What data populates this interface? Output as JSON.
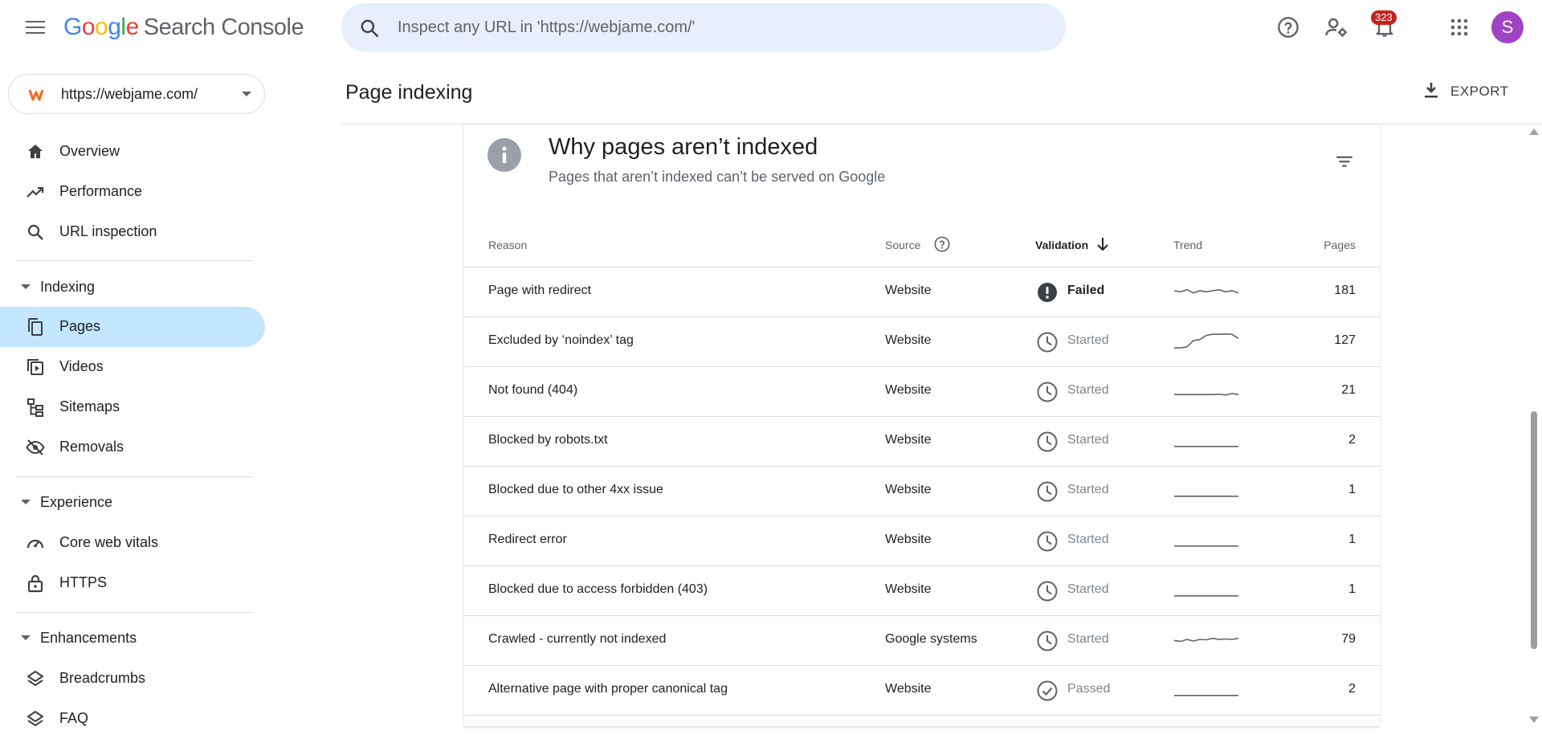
{
  "app": {
    "logo_google": [
      "G",
      "o",
      "o",
      "g",
      "l",
      "e"
    ],
    "product": "Search Console"
  },
  "search": {
    "placeholder": "Inspect any URL in 'https://webjame.com/'"
  },
  "topbar": {
    "notification_count": "323",
    "avatar_initial": "S"
  },
  "property": {
    "label": "https://webjame.com/"
  },
  "sidebar": {
    "top_items": [
      {
        "label": "Overview",
        "icon": "home-icon"
      },
      {
        "label": "Performance",
        "icon": "trending-up-icon"
      },
      {
        "label": "URL inspection",
        "icon": "search-icon"
      }
    ],
    "sections": {
      "indexing": {
        "label": "Indexing",
        "items": [
          {
            "label": "Pages",
            "icon": "pages-icon",
            "active": true
          },
          {
            "label": "Videos",
            "icon": "video-icon"
          },
          {
            "label": "Sitemaps",
            "icon": "sitemap-icon"
          },
          {
            "label": "Removals",
            "icon": "eye-off-icon"
          }
        ]
      },
      "experience": {
        "label": "Experience",
        "items": [
          {
            "label": "Core web vitals",
            "icon": "speedometer-icon"
          },
          {
            "label": "HTTPS",
            "icon": "lock-icon"
          }
        ]
      },
      "enhancements": {
        "label": "Enhancements",
        "items": [
          {
            "label": "Breadcrumbs",
            "icon": "layers-icon"
          },
          {
            "label": "FAQ",
            "icon": "layers-icon"
          }
        ]
      }
    }
  },
  "page": {
    "title": "Page indexing",
    "export_label": "EXPORT"
  },
  "card": {
    "title": "Why pages aren’t indexed",
    "subtitle": "Pages that aren’t indexed can’t be served on Google",
    "columns": {
      "reason": "Reason",
      "source": "Source",
      "validation": "Validation",
      "trend": "Trend",
      "pages": "Pages"
    },
    "rows": [
      {
        "reason": "Page with redirect",
        "source": "Website",
        "validation": "Failed",
        "status": "failed",
        "pages": "181",
        "trend": [
          0.5,
          0.45,
          0.55,
          0.4,
          0.5,
          0.45,
          0.5,
          0.55,
          0.45,
          0.5,
          0.4
        ]
      },
      {
        "reason": "Excluded by ‘noindex’ tag",
        "source": "Website",
        "validation": "Started",
        "status": "started",
        "pages": "127",
        "trend": [
          0.15,
          0.15,
          0.2,
          0.5,
          0.55,
          0.75,
          0.8,
          0.8,
          0.82,
          0.8,
          0.6
        ]
      },
      {
        "reason": "Not found (404)",
        "source": "Website",
        "validation": "Started",
        "status": "started",
        "pages": "21",
        "trend": [
          0.3,
          0.3,
          0.3,
          0.3,
          0.3,
          0.3,
          0.3,
          0.32,
          0.28,
          0.35,
          0.3
        ]
      },
      {
        "reason": "Blocked by robots.txt",
        "source": "Website",
        "validation": "Started",
        "status": "started",
        "pages": "2",
        "trend": [
          0.2,
          0.2,
          0.2,
          0.2,
          0.2,
          0.2,
          0.2,
          0.2,
          0.2,
          0.2,
          0.2
        ]
      },
      {
        "reason": "Blocked due to other 4xx issue",
        "source": "Website",
        "validation": "Started",
        "status": "started",
        "pages": "1",
        "trend": [
          0.2,
          0.2,
          0.2,
          0.2,
          0.2,
          0.2,
          0.2,
          0.2,
          0.2,
          0.2,
          0.2
        ]
      },
      {
        "reason": "Redirect error",
        "source": "Website",
        "validation": "Started",
        "status": "started",
        "pages": "1",
        "trend": [
          0.2,
          0.2,
          0.2,
          0.2,
          0.2,
          0.2,
          0.2,
          0.2,
          0.2,
          0.2,
          0.2
        ]
      },
      {
        "reason": "Blocked due to access forbidden (403)",
        "source": "Website",
        "validation": "Started",
        "status": "started",
        "pages": "1",
        "trend": [
          0.2,
          0.2,
          0.2,
          0.2,
          0.2,
          0.2,
          0.2,
          0.2,
          0.2,
          0.2,
          0.2
        ]
      },
      {
        "reason": "Crawled - currently not indexed",
        "source": "Google systems",
        "validation": "Started",
        "status": "started",
        "pages": "79",
        "trend": [
          0.45,
          0.4,
          0.5,
          0.42,
          0.5,
          0.48,
          0.55,
          0.5,
          0.52,
          0.5,
          0.55
        ]
      },
      {
        "reason": "Alternative page with proper canonical tag",
        "source": "Website",
        "validation": "Passed",
        "status": "passed",
        "pages": "2",
        "trend": [
          0.2,
          0.2,
          0.2,
          0.2,
          0.2,
          0.2,
          0.2,
          0.2,
          0.2,
          0.2,
          0.2
        ]
      }
    ]
  },
  "colors": {
    "active_nav": "#c2e7ff",
    "search_bg": "#e8eefc",
    "badge": "#c5221f",
    "avatar": "#a142c4",
    "failed_icon": "#3c4043",
    "muted": "#80868b"
  }
}
